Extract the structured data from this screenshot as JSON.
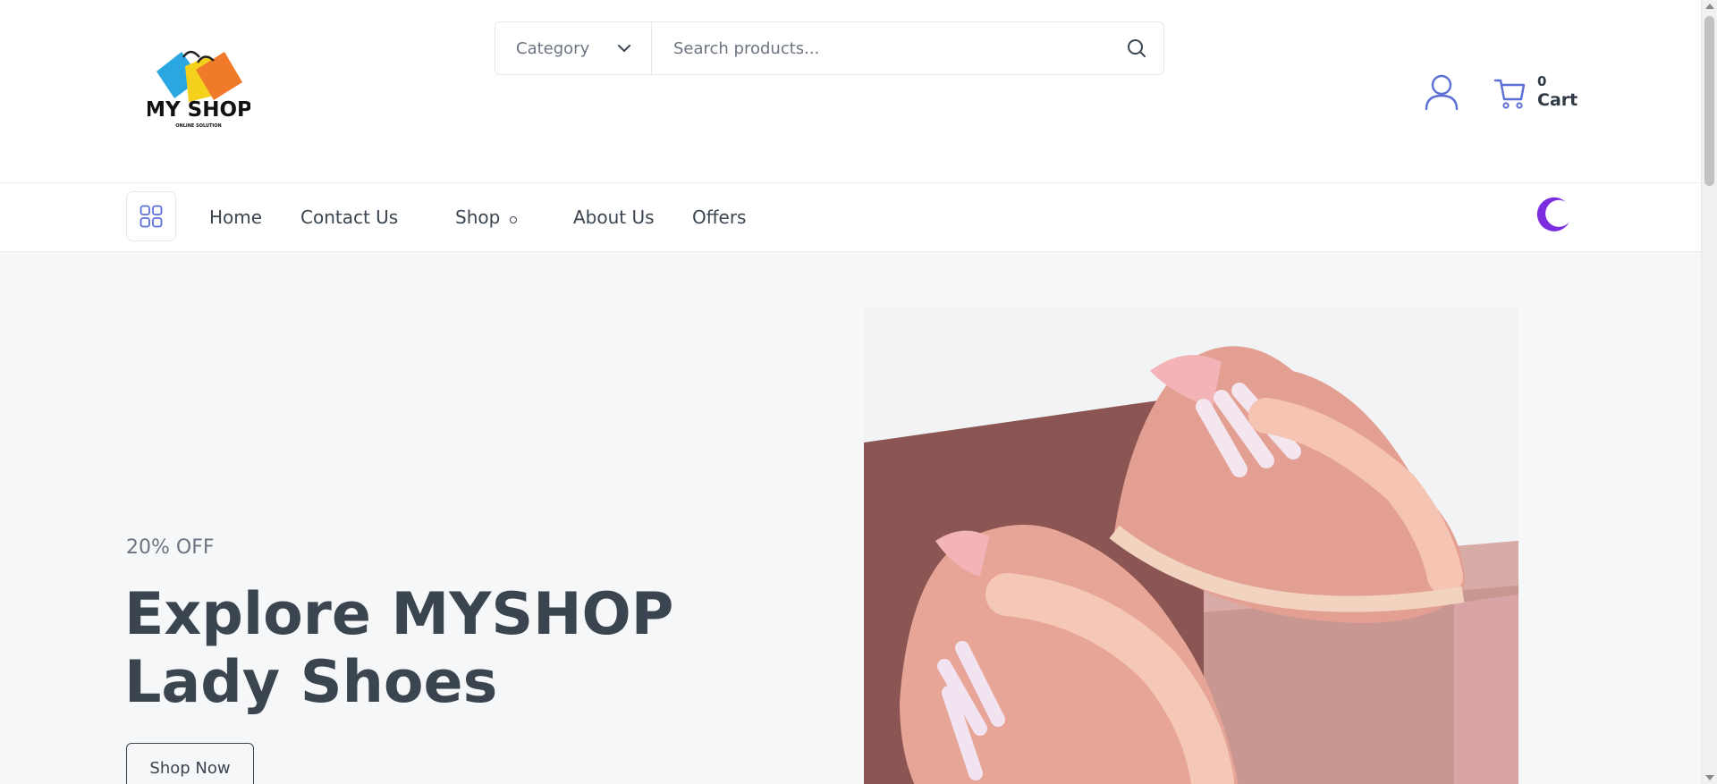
{
  "header": {
    "logo": {
      "name": "MY SHOP",
      "tagline": "ONLINE SOLUTION"
    },
    "search": {
      "category_label": "Category",
      "placeholder": "Search products..."
    },
    "cart": {
      "count": "0",
      "label": "Cart"
    }
  },
  "nav": {
    "items": [
      {
        "label": "Home"
      },
      {
        "label": "Contact Us"
      },
      {
        "label": "Shop"
      },
      {
        "label": "About Us"
      },
      {
        "label": "Offers"
      }
    ]
  },
  "hero": {
    "discount": "20% OFF",
    "title_line1": "Explore MYSHOP",
    "title_line2": "Lady Shoes",
    "cta_label": "Shop Now"
  },
  "icons": {
    "search": "search-icon",
    "chevron": "chevron-down-icon",
    "user": "user-icon",
    "cart": "cart-icon",
    "grid": "grid-icon",
    "theme": "moon-icon"
  },
  "colors": {
    "accent_icon": "#5b6fd6",
    "moon": "#7b2ee0",
    "text": "#3a4550",
    "hero_bg": "#f6f7f9"
  }
}
